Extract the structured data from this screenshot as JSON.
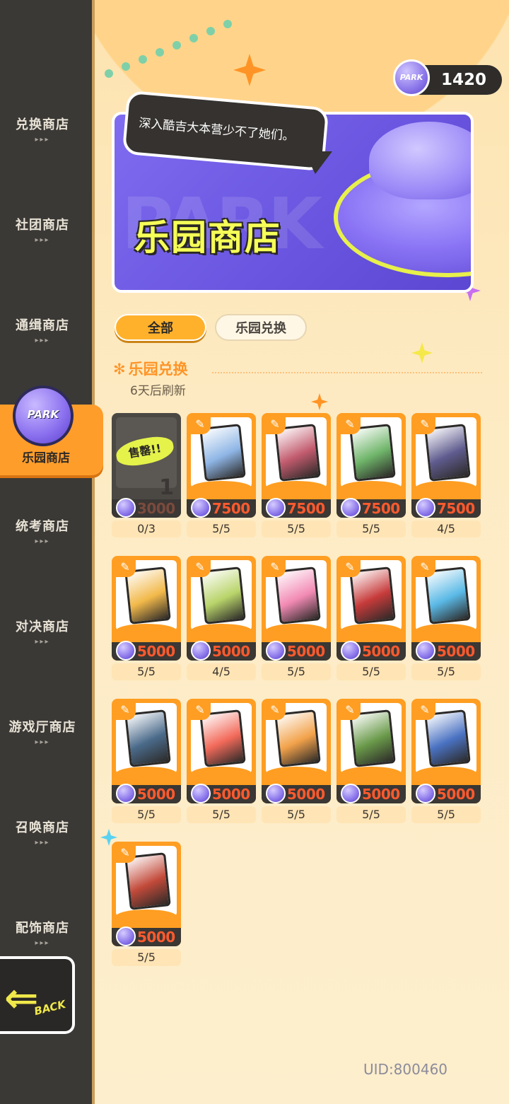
{
  "sidebar": {
    "items": [
      {
        "label": "兑换商店"
      },
      {
        "label": "社团商店"
      },
      {
        "label": "通缉商店"
      },
      {
        "label": "乐园商店",
        "active": true
      },
      {
        "label": "统考商店"
      },
      {
        "label": "对决商店"
      },
      {
        "label": "游戏厅商店"
      },
      {
        "label": "召唤商店"
      },
      {
        "label": "配饰商店"
      }
    ],
    "dots": "▸▸▸",
    "badge_text": "PARK",
    "back_label": "BACK"
  },
  "currency": {
    "coin_text": "PARK",
    "value": "1420"
  },
  "banner": {
    "speech": "深入酷吉大本营少不了她们。",
    "title": "乐园商店"
  },
  "tabs": [
    {
      "label": "全部",
      "selected": true
    },
    {
      "label": "乐园兑换",
      "selected": false
    }
  ],
  "section": {
    "title": "乐园兑换",
    "subtitle": "6天后刷新"
  },
  "items": [
    {
      "price": "3000",
      "stock": "0/3",
      "sold_out": true,
      "sold_label": "售罄!!",
      "count": "1",
      "color": "#6b5fa8"
    },
    {
      "price": "7500",
      "stock": "5/5",
      "color": "#8fb6e6"
    },
    {
      "price": "7500",
      "stock": "5/5",
      "color": "#c25b6e"
    },
    {
      "price": "7500",
      "stock": "5/5",
      "color": "#6fb56a"
    },
    {
      "price": "7500",
      "stock": "4/5",
      "color": "#5f5b8e"
    },
    {
      "price": "5000",
      "stock": "5/5",
      "color": "#f2b94a"
    },
    {
      "price": "5000",
      "stock": "4/5",
      "color": "#b9d46a"
    },
    {
      "price": "5000",
      "stock": "5/5",
      "color": "#f28ab4"
    },
    {
      "price": "5000",
      "stock": "5/5",
      "color": "#c73b3b"
    },
    {
      "price": "5000",
      "stock": "5/5",
      "color": "#5ab9e6"
    },
    {
      "price": "5000",
      "stock": "5/5",
      "color": "#4a6a8a"
    },
    {
      "price": "5000",
      "stock": "5/5",
      "color": "#f26a5a"
    },
    {
      "price": "5000",
      "stock": "5/5",
      "color": "#f2a24a"
    },
    {
      "price": "5000",
      "stock": "5/5",
      "color": "#6a9a4a"
    },
    {
      "price": "5000",
      "stock": "5/5",
      "color": "#4a72c2"
    },
    {
      "price": "5000",
      "stock": "5/5",
      "color": "#c24a3a"
    }
  ],
  "uid": "UID:800460"
}
